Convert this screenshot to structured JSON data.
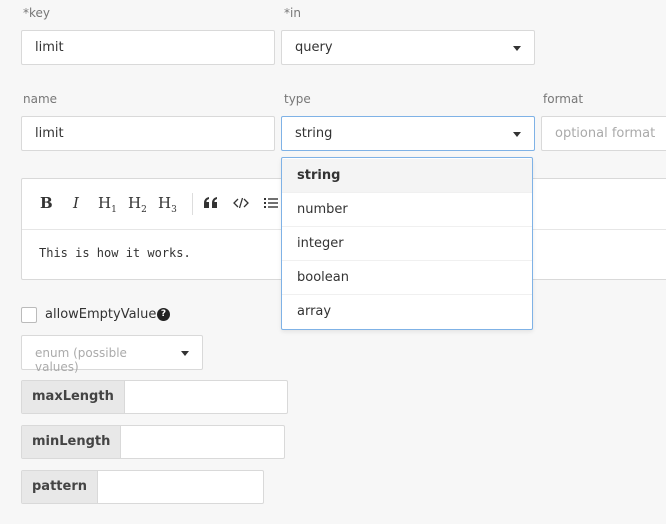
{
  "labels": {
    "key": "*key",
    "in": "*in",
    "name": "name",
    "type": "type",
    "format": "format"
  },
  "fields": {
    "key_value": "limit",
    "in_value": "query",
    "name_value": "limit",
    "type_value": "string",
    "format_placeholder": "optional format"
  },
  "editor": {
    "toolbar": [
      "B",
      "I",
      "H1",
      "H2",
      "H3",
      "quote",
      "code",
      "list"
    ],
    "content": "This is how it works."
  },
  "allow_empty": {
    "label": "allowEmptyValue",
    "help_icon": "question-circle-icon",
    "checked": false
  },
  "enum": {
    "placeholder": "enum (possible values)"
  },
  "constraints": [
    {
      "label": "maxLength",
      "value": ""
    },
    {
      "label": "minLength",
      "value": ""
    },
    {
      "label": "pattern",
      "value": ""
    }
  ],
  "type_options": [
    "string",
    "number",
    "integer",
    "boolean",
    "array"
  ],
  "type_selected": "string",
  "colors": {
    "focus_border": "#7fb2e6",
    "background": "#f7f7f7"
  }
}
